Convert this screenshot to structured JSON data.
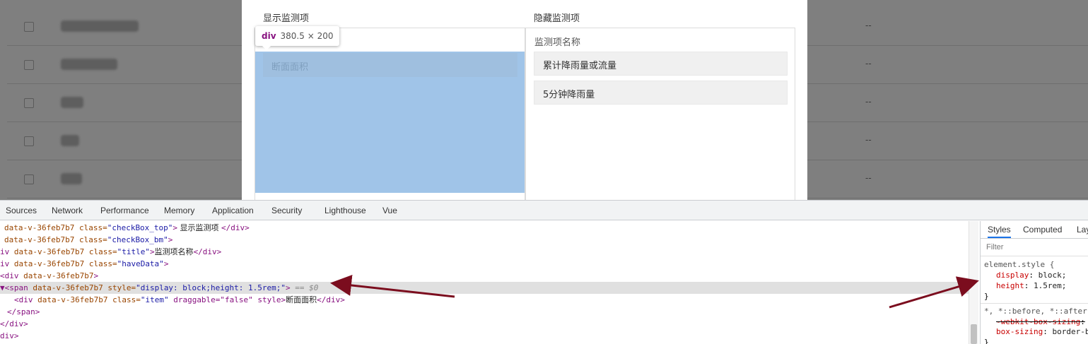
{
  "page_rows": [
    {
      "dash": "--"
    },
    {
      "dash": "--"
    },
    {
      "dash": "--"
    },
    {
      "dash": "--"
    },
    {
      "dash": "--"
    }
  ],
  "modal": {
    "left_title": "显示监测项",
    "right_title": "隐藏监测项",
    "left_items": [
      "断面面积"
    ],
    "right_subtitle": "监测项名称",
    "right_items": [
      "累计降雨量或流量",
      "5分钟降雨量"
    ]
  },
  "tooltip": {
    "tag": "div",
    "size": "380.5 × 200"
  },
  "devtools": {
    "tabs": [
      "Sources",
      "Network",
      "Performance",
      "Memory",
      "Application",
      "Security",
      "Lighthouse",
      "Vue"
    ],
    "dom_lines": [
      {
        "indent": " ",
        "pre": "",
        "tag_open": "",
        "attrs": "data-v-36feb7b7 class=",
        "val": "\"checkBox_top\"",
        "tail": ">",
        "text": " 显示监测项 ",
        "close": "</div>"
      },
      {
        "indent": " ",
        "pre": "",
        "tag_open": "",
        "attrs": "data-v-36feb7b7 class=",
        "val": "\"checkBox_bm\"",
        "tail": ">",
        "text": "",
        "close": ""
      },
      {
        "indent": "",
        "pre": "",
        "tag_open": "iv ",
        "attrs": "data-v-36feb7b7 class=",
        "val": "\"title\"",
        "tail": ">",
        "text": "监测项名称",
        "close": "</div>"
      },
      {
        "indent": "",
        "pre": "",
        "tag_open": "iv ",
        "attrs": "data-v-36feb7b7 class=",
        "val": "\"haveData\"",
        "tail": ">",
        "text": "",
        "close": ""
      },
      {
        "indent": "",
        "pre": "",
        "tag_open": "<div ",
        "attrs": "data-v-36feb7b7",
        "val": "",
        "tail": ">",
        "text": "",
        "close": ""
      },
      {
        "indent": "",
        "pre": "▼",
        "tag_open": "<span ",
        "attrs": "data-v-36feb7b7 style=",
        "val": "\"display: block;height: 1.5rem;\"",
        "tail": ">",
        "text": "",
        "close": "",
        "eq": " == $0",
        "selected": true
      },
      {
        "indent": "    ",
        "pre": "",
        "tag_open": "<div ",
        "attrs": "data-v-36feb7b7 class=",
        "val": "\"item\"",
        "tail": " draggable=\"false\" style>",
        "text": "断面面积",
        "close": "</div>"
      },
      {
        "indent": "  ",
        "pre": "",
        "tag_open": "</span>",
        "attrs": "",
        "val": "",
        "tail": "",
        "text": "",
        "close": ""
      },
      {
        "indent": "",
        "pre": "",
        "tag_open": "</div>",
        "attrs": "",
        "val": "",
        "tail": "",
        "text": "",
        "close": ""
      },
      {
        "indent": "",
        "pre": "",
        "tag_open": "div>",
        "attrs": "",
        "val": "",
        "tail": "",
        "text": "",
        "close": ""
      }
    ],
    "styles_tabs": [
      "Styles",
      "Computed",
      "Lay"
    ],
    "filter_placeholder": "Filter",
    "element_style": {
      "selector": "element.style {",
      "props": [
        {
          "name": "display",
          "value": "block;"
        },
        {
          "name": "height",
          "value": "1.5rem;"
        }
      ],
      "close": "}"
    },
    "universal_rule": {
      "selector": "*, *::before, *::after",
      "props": [
        {
          "name": "-webkit-box-sizing",
          "value": "",
          "struck": true
        },
        {
          "name": "box-sizing",
          "value": "border-b"
        }
      ],
      "close": "}"
    }
  },
  "colors": {
    "annotation_arrow": "#7b0d1e",
    "highlight": "#a0c4e8",
    "tab_active": "#1a73e8"
  }
}
